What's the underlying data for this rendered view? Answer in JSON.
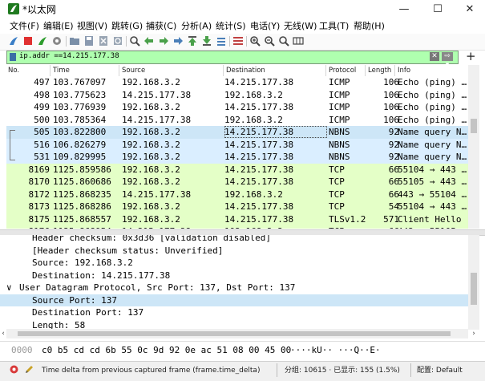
{
  "window": {
    "title": "*以太网",
    "minimize": "—",
    "maximize": "☐",
    "close": "✕"
  },
  "menu": [
    "文件(F)",
    "编辑(E)",
    "视图(V)",
    "跳转(G)",
    "捕获(C)",
    "分析(A)",
    "统计(S)",
    "电话(Y)",
    "无线(W)",
    "工具(T)",
    "帮助(H)"
  ],
  "toolbar_icons": [
    "shark-fin-start-icon",
    "stop-icon",
    "restart-icon",
    "options-gear-icon",
    "open-folder-icon",
    "save-file-icon",
    "close-file-icon",
    "reload-icon",
    "find-icon",
    "back-arrow-icon",
    "forward-arrow-icon",
    "goto-packet-icon",
    "first-packet-icon",
    "last-packet-icon",
    "autoscroll-icon",
    "colorize-icon",
    "zoom-in-icon",
    "zoom-out-icon",
    "zoom-normal-icon",
    "resize-columns-icon"
  ],
  "filter": {
    "value": "ip.addr ==14.215.177.38",
    "clear": "✕",
    "apply": "⇨ ▾",
    "add": "+"
  },
  "columns": [
    "No.",
    "Time",
    "Source",
    "Destination",
    "Protocol",
    "Length",
    "Info"
  ],
  "packets": [
    {
      "no": "497",
      "time": "103.767097",
      "src": "192.168.3.2",
      "dst": "14.215.177.38",
      "proto": "ICMP",
      "len": "106",
      "info": "Echo (ping) …",
      "kind": "other"
    },
    {
      "no": "498",
      "time": "103.775623",
      "src": "14.215.177.38",
      "dst": "192.168.3.2",
      "proto": "ICMP",
      "len": "106",
      "info": "Echo (ping) …",
      "kind": "other"
    },
    {
      "no": "499",
      "time": "103.776939",
      "src": "192.168.3.2",
      "dst": "14.215.177.38",
      "proto": "ICMP",
      "len": "106",
      "info": "Echo (ping) …",
      "kind": "other"
    },
    {
      "no": "500",
      "time": "103.785364",
      "src": "14.215.177.38",
      "dst": "192.168.3.2",
      "proto": "ICMP",
      "len": "106",
      "info": "Echo (ping) …",
      "kind": "other"
    },
    {
      "no": "505",
      "time": "103.822800",
      "src": "192.168.3.2",
      "dst": "14.215.177.38",
      "proto": "NBNS",
      "len": "92",
      "info": "Name query N…",
      "kind": "selected"
    },
    {
      "no": "516",
      "time": "106.826279",
      "src": "192.168.3.2",
      "dst": "14.215.177.38",
      "proto": "NBNS",
      "len": "92",
      "info": "Name query N…",
      "kind": "udp"
    },
    {
      "no": "531",
      "time": "109.829995",
      "src": "192.168.3.2",
      "dst": "14.215.177.38",
      "proto": "NBNS",
      "len": "92",
      "info": "Name query N…",
      "kind": "udp"
    },
    {
      "no": "8169",
      "time": "1125.859586",
      "src": "192.168.3.2",
      "dst": "14.215.177.38",
      "proto": "TCP",
      "len": "66",
      "info": "55104 → 443 …",
      "kind": "tcp"
    },
    {
      "no": "8170",
      "time": "1125.860686",
      "src": "192.168.3.2",
      "dst": "14.215.177.38",
      "proto": "TCP",
      "len": "66",
      "info": "55105 → 443 …",
      "kind": "tcp"
    },
    {
      "no": "8172",
      "time": "1125.868235",
      "src": "14.215.177.38",
      "dst": "192.168.3.2",
      "proto": "TCP",
      "len": "66",
      "info": "443 → 55104 …",
      "kind": "tcp"
    },
    {
      "no": "8173",
      "time": "1125.868286",
      "src": "192.168.3.2",
      "dst": "14.215.177.38",
      "proto": "TCP",
      "len": "54",
      "info": "55104 → 443 …",
      "kind": "tcp"
    },
    {
      "no": "8175",
      "time": "1125.868557",
      "src": "192.168.3.2",
      "dst": "14.215.177.38",
      "proto": "TLSv1.2",
      "len": "571",
      "info": "Client Hello",
      "kind": "tcp"
    },
    {
      "no": "8176",
      "time": "1125.868954",
      "src": "14.215.177.38",
      "dst": "192.168.3.2",
      "proto": "TCP",
      "len": "66",
      "info": "443 → 55105 …",
      "kind": "tcp"
    }
  ],
  "details": [
    {
      "text": "Header checksum: 0x3d36 [validation disabled]",
      "indent": 1,
      "expander": "",
      "hl": false
    },
    {
      "text": "[Header checksum status: Unverified]",
      "indent": 1,
      "expander": "",
      "hl": false
    },
    {
      "text": "Source: 192.168.3.2",
      "indent": 1,
      "expander": "",
      "hl": false
    },
    {
      "text": "Destination: 14.215.177.38",
      "indent": 1,
      "expander": "",
      "hl": false
    },
    {
      "text": "User Datagram Protocol, Src Port: 137, Dst Port: 137",
      "indent": 0,
      "expander": "∨",
      "hl": false
    },
    {
      "text": "Source Port: 137",
      "indent": 1,
      "expander": "",
      "hl": true
    },
    {
      "text": "Destination Port: 137",
      "indent": 1,
      "expander": "",
      "hl": false
    },
    {
      "text": "Length: 58",
      "indent": 1,
      "expander": "",
      "hl": false
    }
  ],
  "bytes": {
    "offset": "0000",
    "hex": "c0 b5 cd cd 6b 55 0c 9d  92 0e ac 51 08 00 45 00",
    "ascii": "····kU·· ···Q··E·"
  },
  "status": {
    "field": "Time delta from previous captured frame (frame.time_delta)",
    "packets": "分组: 10615 · 已显示: 155 (1.5%)",
    "profile": "配置: Default"
  },
  "colors": {
    "filter_ok": "#afffaf",
    "tcp_row": "#e4ffc7",
    "udp_row": "#daeeff",
    "selected_row": "#cde6f7",
    "accent": "#1f7a1f"
  }
}
